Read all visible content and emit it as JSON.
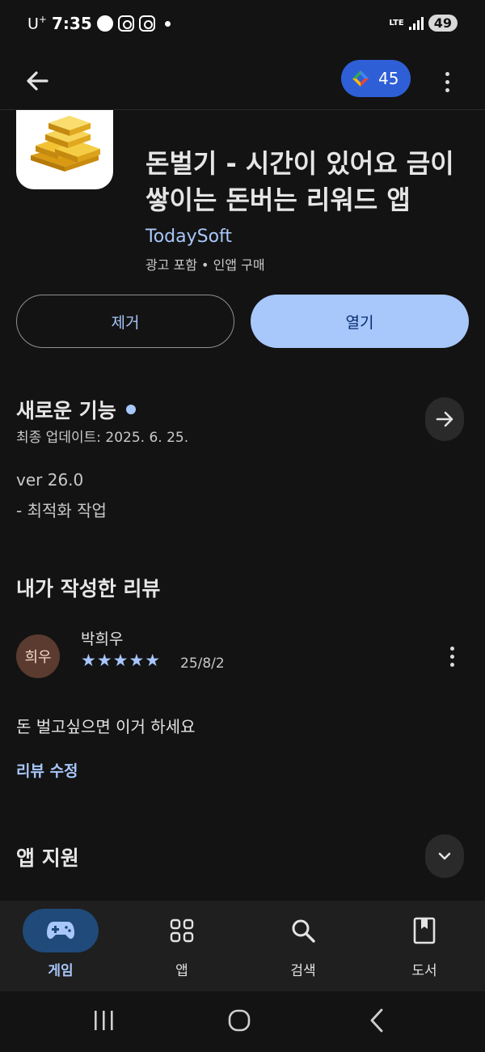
{
  "status_bar": {
    "carrier": "U",
    "carrier_sup": "+",
    "time": "7:35",
    "network": "LTE",
    "battery": "49"
  },
  "top_bar": {
    "points": "45"
  },
  "app": {
    "title": "돈벌기 - 시간이 있어요 금이 쌓이는 돈버는 리워드 앱",
    "developer": "TodaySoft",
    "meta": "광고 포함 • 인앱 구매",
    "uninstall_label": "제거",
    "open_label": "열기"
  },
  "whats_new": {
    "title": "새로운 기능",
    "updated": "최종 업데이트: 2025. 6. 25.",
    "version": "ver 26.0",
    "notes": "- 최적화 작업"
  },
  "my_review": {
    "section_title": "내가 작성한 리뷰",
    "avatar_text": "희우",
    "reviewer": "박희우",
    "rating": 5,
    "stars": "★★★★★",
    "date": "25/8/2",
    "text": "돈 벌고싶으면 이거 하세요",
    "edit_label": "리뷰 수정"
  },
  "app_support": {
    "title": "앱 지원"
  },
  "bottom_nav": {
    "games": "게임",
    "apps": "앱",
    "search": "검색",
    "books": "도서"
  },
  "colors": {
    "background": "#131313",
    "accent": "#a8c7fa",
    "points_pill": "#2f5fd6",
    "active_nav": "#1f4a79"
  }
}
